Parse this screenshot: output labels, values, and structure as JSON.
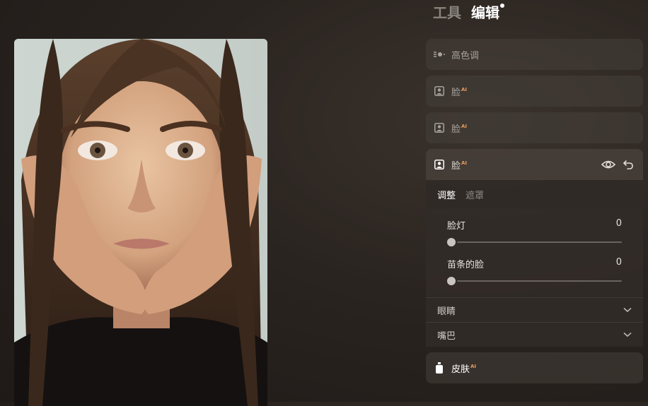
{
  "tabs": {
    "tools": "工具",
    "edit": "编辑"
  },
  "panel": {
    "items": [
      {
        "label": "高色调",
        "icon": "light-icon"
      },
      {
        "label": "脸",
        "ai": "AI",
        "icon": "portrait-icon"
      },
      {
        "label": "脸",
        "ai": "AI",
        "icon": "portrait-icon"
      }
    ],
    "expanded": {
      "label": "脸",
      "ai": "AI",
      "subtabs": [
        "调整",
        "遮罩"
      ],
      "sliders": [
        {
          "label": "脸灯",
          "value": "0"
        },
        {
          "label": "苗条的脸",
          "value": "0"
        }
      ],
      "sections": [
        "眼睛",
        "嘴巴"
      ]
    },
    "skin": {
      "label": "皮肤",
      "ai": "AI",
      "icon": "bottle-icon"
    }
  }
}
